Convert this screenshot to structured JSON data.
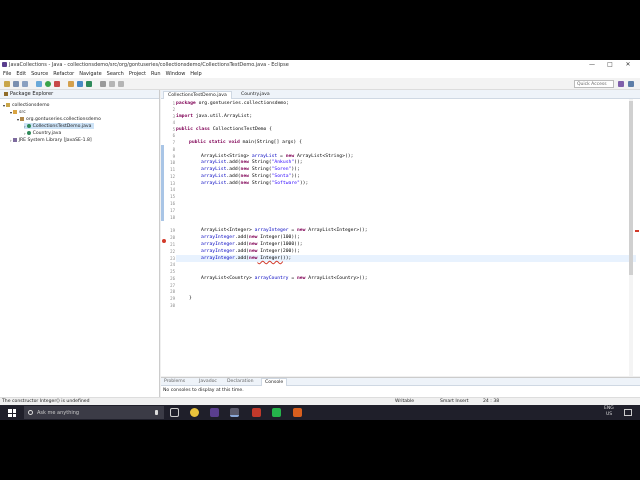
{
  "window": {
    "title": "JavaCollections - Java - collectionsdemo/src/org/gontuseries/collectionsdemo/CollectionsTestDemo.java - Eclipse",
    "minimize": "—",
    "maximize": "□",
    "close": "✕"
  },
  "menu": [
    "File",
    "Edit",
    "Source",
    "Refactor",
    "Navigate",
    "Search",
    "Project",
    "Run",
    "Window",
    "Help"
  ],
  "toolbar": {
    "quick_access": "Quick Access"
  },
  "explorer": {
    "tab": "Package Explorer",
    "tree": [
      "collectionsdemo",
      "src",
      "org.gontuseries.collectionsdemo",
      "CollectionsTestDemo.java",
      "Country.java",
      "JRE System Library [JavaSE-1.8]"
    ]
  },
  "editor": {
    "tabs": [
      "CollectionsTestDemo.java",
      "Country.java"
    ],
    "line_numbers": [
      "1",
      "2",
      "3",
      "4",
      "5",
      "6",
      "7",
      "8",
      "9",
      "10",
      "11",
      "12",
      "13",
      "14",
      "15",
      "16",
      "17",
      "18",
      "19",
      "20",
      "21",
      "22",
      "23",
      "24",
      "25",
      "26",
      "27",
      "28",
      "29",
      "30"
    ],
    "code": {
      "l1_kw": "package",
      "l1": " org.gontuseries.collectionsdemo;",
      "l3_kw": "import",
      "l3": " java.util.ArrayList;",
      "l5_kw": "public class",
      "l5": " CollectionsTestDemo {",
      "l7_kw": "public static void",
      "l7": " main(String[] args) {",
      "l9a": "ArrayList<String> ",
      "l9v": "arrayList",
      "l9b": " = ",
      "l9k": "new",
      "l9c": " ArrayList<String>();",
      "l10v": "arrayList",
      "l10a": ".add(",
      "l10k": "new",
      "l10b": " String(",
      "l10s": "\"Ankush\"",
      "l10c": "));",
      "l11v": "arrayList",
      "l11a": ".add(",
      "l11k": "new",
      "l11b": " String(",
      "l11s": "\"Soren\"",
      "l11c": "));",
      "l12v": "arrayList",
      "l12a": ".add(",
      "l12k": "new",
      "l12b": " String(",
      "l12s": "\"Sonta\"",
      "l12c": "));",
      "l13v": "arrayList",
      "l13a": ".add(",
      "l13k": "new",
      "l13b": " String(",
      "l13s": "\"Software\"",
      "l13c": "));",
      "l19a": "ArrayList<Integer> ",
      "l19v": "arrayInteger",
      "l19b": " = ",
      "l19k": "new",
      "l19c": " ArrayList<Integer>();",
      "l20v": "arrayInteger",
      "l20a": ".add(",
      "l20k": "new",
      "l20b": " Integer(100));",
      "l21v": "arrayInteger",
      "l21a": ".add(",
      "l21k": "new",
      "l21b": " Integer(1000));",
      "l22v": "arrayInteger",
      "l22a": ".add(",
      "l22k": "new",
      "l22b": " Integer(200));",
      "l23v": "arrayInteger",
      "l23a": ".add(",
      "l23k": "new",
      "l23b": " Integer(",
      "l23c": "));",
      "l26a": "ArrayList<Country> ",
      "l26v": "arrayCountry",
      "l26b": " = ",
      "l26k": "new",
      "l26c": " ArrayList<Country>();",
      "l29": "}"
    }
  },
  "bottom": {
    "tabs": [
      "Problems",
      "Javadoc",
      "Declaration",
      "Console"
    ],
    "message": "No consoles to display at this time."
  },
  "status": {
    "error": "The constructor Integer() is undefined",
    "writable": "Writable",
    "insert": "Smart Insert",
    "position": "24 : 38"
  },
  "taskbar": {
    "search": "Ask me anything",
    "lang": "ENG",
    "region": "US"
  }
}
